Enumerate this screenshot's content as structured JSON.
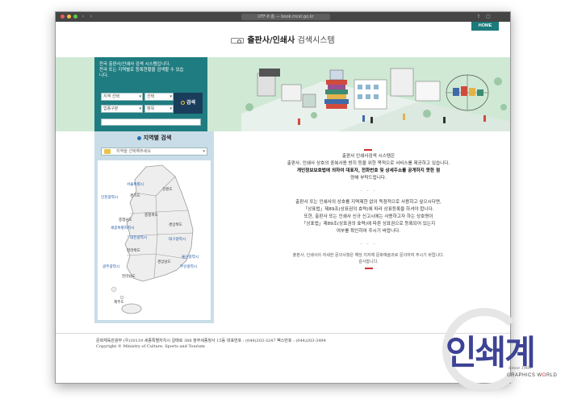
{
  "browser": {
    "url": "book.mcst.go.kr",
    "tab_title": "UTF-8 홈"
  },
  "header": {
    "home_label": "HOME",
    "title_bold": "출판사/인쇄사",
    "title_light": "검색시스템"
  },
  "search": {
    "intro_line1": "전국 출판사/인쇄사 검색 시스템입니다.",
    "intro_line2": "전국 또는 지역별로 등록현황을 검색할 수 있습",
    "intro_line3": "니다.",
    "region_select": "지역 선택",
    "type_select": "선택",
    "category_select": "업종구분",
    "field_select": "항목",
    "button_label": "검색"
  },
  "region": {
    "title": "지역별 검색",
    "select_placeholder": "지역을 선택해주세요",
    "labels": {
      "seoul": "서울특별시",
      "incheon": "인천광역시",
      "gyeonggi": "경기도",
      "gangwon": "강원도",
      "chungbuk": "충청북도",
      "chungnam": "충청남도",
      "sejong": "세종특별자치시",
      "daejeon": "대전광역시",
      "gyeongbuk": "경상북도",
      "daegu": "대구광역시",
      "jeonbuk": "전라북도",
      "ulsan": "울산광역시",
      "gyeongnam": "경상남도",
      "busan": "부산광역시",
      "gwangju": "광주광역시",
      "jeonnam": "전라남도",
      "jeju": "제주도"
    }
  },
  "info": {
    "p1_l1": "출판사 인쇄사검색 시스템은",
    "p1_l2": "출판사, 인쇄사 상호의 중복사용 방지 등을 위한 목적으로 서비스를 제공하고 있습니다.",
    "p1_l3": "개인정보보호법에 의하여 대표자, 전화번호 및 상세주소를 공개하지 못한 점",
    "p1_l4": "양해 부탁드립니다.",
    "dots": "- - -",
    "p2_l1": "출판사 또는 인쇄사의 상호를 지역제한 없이 독점적으로 사용하고 싶으시다면,",
    "p2_l2": "「상표법」제89조(상표권의 효력)에 따라 상표등록을 하셔야 합니다.",
    "p2_l3": "또한, 출판사 또는 인쇄사 신규 신고시에는 사용하고자 하는 상호명이",
    "p2_l4": "「상표법」제89조(상표권의 효력)에 따른 상표권으로 등록되어 있는지",
    "p2_l5": "여부를 확인하여 주시기 바랍니다.",
    "p3_l1": "출판사, 인쇄사의 자세한 문의사항은 해당 지자체 문화예술과로 문의하여 주시기 바랍니다.",
    "p3_l2": "감사합니다."
  },
  "footer": {
    "line1": "문화체육관광부 (우)30119 세종특별자치시 갈매로 388 정부세종청사 15동 대표번호 : (044)203-3247 팩스번호 : (044)203-3494",
    "line2": "Copyright © Ministry of Culture, Sports and Tourism"
  },
  "logo": {
    "text": "인쇄계",
    "since": "Since 1969",
    "brand_pre": "GRAPHICS W",
    "brand_o": "O",
    "brand_post": "RLD"
  },
  "colors": {
    "teal": "#1f7c80",
    "navy_button": "#1a3d5c",
    "region_bg": "#c9dde8",
    "hero_bg": "#cfe9d5",
    "accent_red": "#d62d2d",
    "logo_purple": "#3d4394"
  }
}
